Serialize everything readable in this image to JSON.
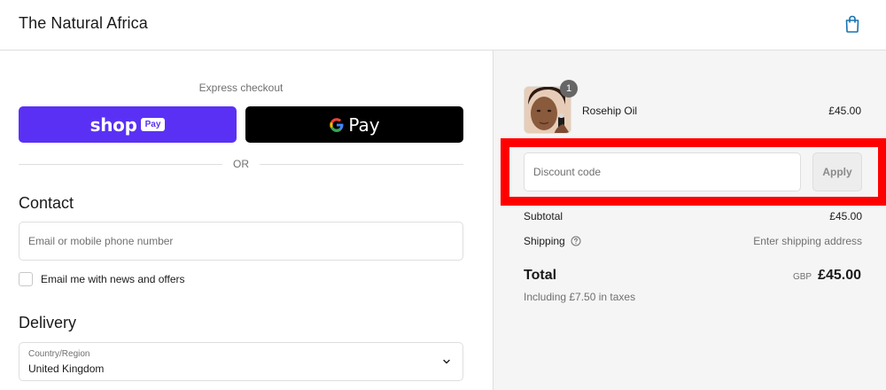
{
  "header": {
    "brand": "The Natural Africa",
    "cart_icon": "shopping-bag-icon",
    "accent_color": "#1773b0"
  },
  "express": {
    "label": "Express checkout",
    "shop_pay": {
      "word": "shop",
      "badge": "Pay",
      "color": "#5a31f4"
    },
    "gpay": {
      "text": "Pay",
      "g_glyph": "G"
    },
    "or_text": "OR"
  },
  "contact": {
    "title": "Contact",
    "email_placeholder": "Email or mobile phone number",
    "news_label": "Email me with news and offers"
  },
  "delivery": {
    "title": "Delivery",
    "country_label": "Country/Region",
    "country_value": "United Kingdom"
  },
  "order": {
    "product": {
      "name": "Rosehip Oil",
      "price": "£45.00",
      "quantity": "1"
    },
    "discount": {
      "placeholder": "Discount code",
      "apply_label": "Apply",
      "highlight_color": "#ff0000"
    },
    "subtotal": {
      "label": "Subtotal",
      "value": "£45.00"
    },
    "shipping": {
      "label": "Shipping",
      "value": "Enter shipping address"
    },
    "total": {
      "label": "Total",
      "currency": "GBP",
      "value": "£45.00"
    },
    "tax_note": "Including £7.50 in taxes"
  }
}
